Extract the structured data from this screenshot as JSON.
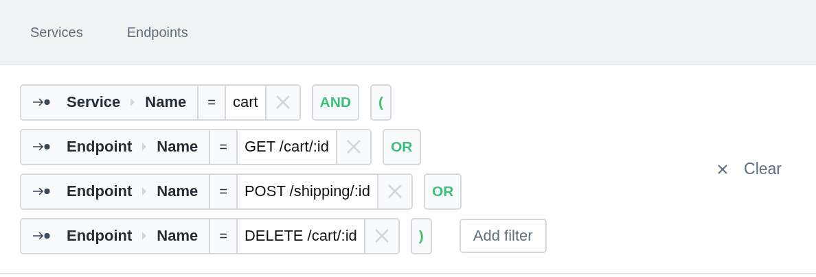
{
  "tabs": [
    {
      "label": "Services"
    },
    {
      "label": "Endpoints"
    }
  ],
  "filters": [
    {
      "entity": "Service",
      "field": "Name",
      "operator": "=",
      "value": "cart",
      "tokens": [
        "AND",
        "("
      ]
    },
    {
      "entity": "Endpoint",
      "field": "Name",
      "operator": "=",
      "value": "GET /cart/:id",
      "tokens": [
        "OR"
      ]
    },
    {
      "entity": "Endpoint",
      "field": "Name",
      "operator": "=",
      "value": "POST /shipping/:id",
      "tokens": [
        "OR"
      ]
    },
    {
      "entity": "Endpoint",
      "field": "Name",
      "operator": "=",
      "value": "DELETE /cart/:id",
      "tokens": [
        ")"
      ]
    }
  ],
  "add_filter": {
    "label": "Add filter"
  },
  "clear": {
    "label": "Clear"
  }
}
